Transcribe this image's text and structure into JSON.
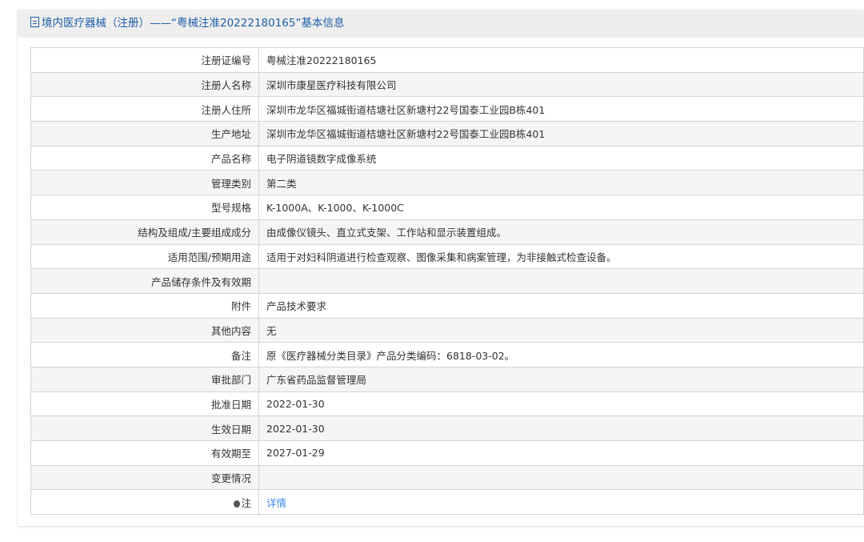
{
  "header": {
    "title": "境内医疗器械（注册）——“粤械注准20222180165”基本信息"
  },
  "rows": [
    {
      "k": "注册证编号",
      "v": "粤械注准20222180165"
    },
    {
      "k": "注册人名称",
      "v": "深圳市康星医疗科技有限公司"
    },
    {
      "k": "注册人住所",
      "v": "深圳市龙华区福城街道桔塘社区新塘村22号国泰工业园B栋401"
    },
    {
      "k": "生产地址",
      "v": "深圳市龙华区福城街道桔塘社区新塘村22号国泰工业园B栋401"
    },
    {
      "k": "产品名称",
      "v": "电子阴道镜数字成像系统"
    },
    {
      "k": "管理类别",
      "v": "第二类"
    },
    {
      "k": "型号规格",
      "v": "K-1000A、K-1000、K-1000C"
    },
    {
      "k": "结构及组成/主要组成成分",
      "v": "由成像仪镜头、直立式支架、工作站和显示装置组成。"
    },
    {
      "k": "适用范围/预期用途",
      "v": "适用于对妇科阴道进行检查观察、图像采集和病案管理，为非接触式检查设备。"
    },
    {
      "k": "产品储存条件及有效期",
      "v": ""
    },
    {
      "k": "附件",
      "v": "产品技术要求"
    },
    {
      "k": "其他内容",
      "v": "无"
    },
    {
      "k": "备注",
      "v": "原《医疗器械分类目录》产品分类编码：6818-03-02。"
    },
    {
      "k": "审批部门",
      "v": "广东省药品监督管理局"
    },
    {
      "k": "批准日期",
      "v": "2022-01-30"
    },
    {
      "k": "生效日期",
      "v": "2022-01-30"
    },
    {
      "k": "有效期至",
      "v": "2027-01-29"
    },
    {
      "k": "变更情况",
      "v": ""
    }
  ],
  "note": {
    "label": "注",
    "link": "详情"
  }
}
